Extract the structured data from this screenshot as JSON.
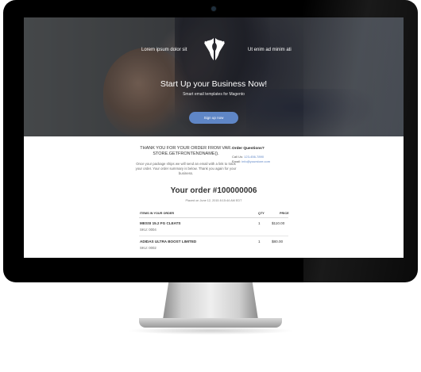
{
  "hero": {
    "nav_left": "Lorem ipsum dolor sit",
    "nav_right": "Ut enim ad minim ati",
    "logo_icon": "hands-logo-icon",
    "title": "Start Up your Business Now!",
    "subtitle": "Smart email templates for Magento",
    "cta_label": "Sign up now"
  },
  "email": {
    "thanks_title": "THANK YOU FOR YOUR ORDER FROM VAR. STORE.GETFRONTENDNAME().",
    "thanks_body": "Once your package ships we will send an email with a link to track your order. Your order summary is below. Thank you again for your business.",
    "questions_title": "Order Questions?",
    "call_label": "Call Us:",
    "call_value": "123-456-7890",
    "email_label": "Email:",
    "email_value": "info@yourstore.com",
    "order_title": "Your order #100000006",
    "placed_text": "Placed on June 12, 2015 8:15:44 AM EDT",
    "headers": {
      "items": "ITEMS IN YOUR ORDER",
      "qty": "QTY",
      "price": "PRICE"
    },
    "items": [
      {
        "name": "MESSI 15.2 FG CLEATS",
        "sku": "SKU: 0004",
        "qty": "1",
        "price": "$110.00"
      },
      {
        "name": "ADIDAS ULTRA BOOST LIMITED",
        "sku": "SKU: 0002",
        "qty": "1",
        "price": "$80.00"
      }
    ]
  },
  "colors": {
    "accent": "#5f86c6",
    "bezel": "#000000"
  }
}
